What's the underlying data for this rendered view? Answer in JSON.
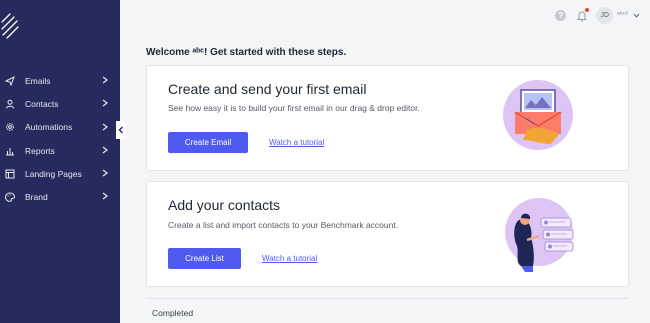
{
  "sidebar": {
    "items": [
      {
        "label": "Emails",
        "icon": "send-icon"
      },
      {
        "label": "Contacts",
        "icon": "user-icon"
      },
      {
        "label": "Automations",
        "icon": "gear-icon"
      },
      {
        "label": "Reports",
        "icon": "bar-chart-icon"
      },
      {
        "label": "Landing Pages",
        "icon": "layout-icon"
      },
      {
        "label": "Brand",
        "icon": "palette-icon"
      }
    ]
  },
  "topbar": {
    "help": "?",
    "avatar_initials": "JD",
    "username": "ᵃᵇᶜᵈ"
  },
  "main": {
    "welcome": "Welcome  ᵃᵇᶜ! Get started with these steps.",
    "cards": [
      {
        "title": "Create and send your first email",
        "description": "See how easy it is to build your first email in our drag & drop editor.",
        "button": "Create Email",
        "link": "Watch a tutorial"
      },
      {
        "title": "Add your contacts",
        "description": "Create a list and import contacts to your Benchmark account.",
        "button": "Create List",
        "link": "Watch a tutorial"
      }
    ],
    "completed": "Completed"
  },
  "colors": {
    "sidebar": "#262a5c",
    "accent": "#4f5bef",
    "illustration_bg": "#dcc4f5"
  }
}
